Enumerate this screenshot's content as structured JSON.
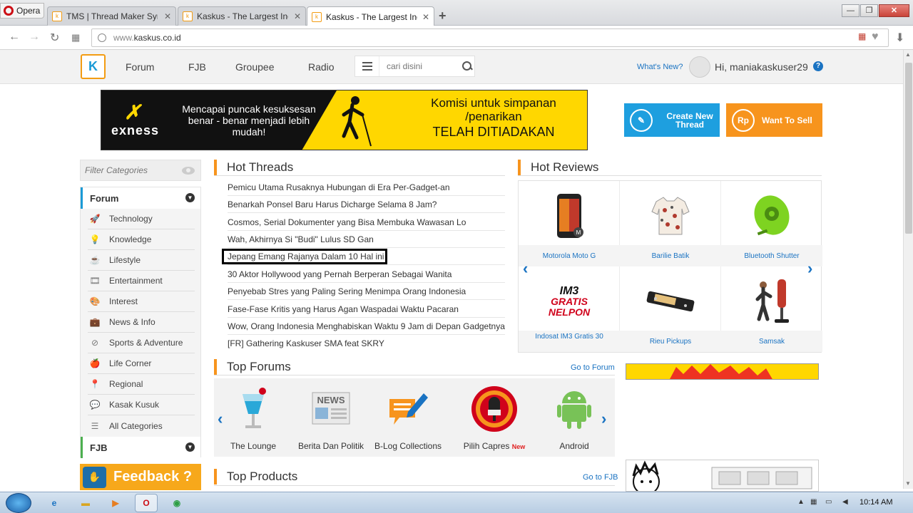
{
  "browser": {
    "menu_label": "Opera",
    "tabs": [
      {
        "title": "TMS | Thread Maker Synd",
        "favicon": "kaskus-favicon"
      },
      {
        "title": "Kaskus - The Largest Indo",
        "favicon": "kaskus-favicon"
      },
      {
        "title": "Kaskus - The Largest Indo",
        "favicon": "kaskus-favicon",
        "active": true
      }
    ],
    "new_tab": "+",
    "url_host": "www.",
    "url_domain": "kaskus.co.id",
    "window_controls": {
      "minimize": "—",
      "maximize": "❐",
      "close": "✕"
    }
  },
  "header": {
    "logo": "K",
    "nav": [
      "Forum",
      "FJB",
      "Groupee",
      "Radio"
    ],
    "search_placeholder": "cari disini",
    "whats_new": "What's New?",
    "greeting": "Hi, maniakaskuser29",
    "help": "?"
  },
  "banner": {
    "brand": "exness",
    "line1": "Mencapai puncak kesuksesan benar - benar menjadi lebih mudah!",
    "line2": "Komisi untuk simpanan /penarikan",
    "line3": "TELAH DITIADAKAN"
  },
  "cta": {
    "create_thread": "Create New Thread",
    "create_icon": "pencil-icon",
    "want_to_sell": "Want To Sell",
    "sell_icon_text": "Rp"
  },
  "sidebar": {
    "filter_placeholder": "Filter Categories",
    "forum_heading": "Forum",
    "items": [
      {
        "label": "Technology",
        "icon": "rocket-icon"
      },
      {
        "label": "Knowledge",
        "icon": "bulb-icon"
      },
      {
        "label": "Lifestyle",
        "icon": "cup-icon"
      },
      {
        "label": "Entertainment",
        "icon": "film-icon"
      },
      {
        "label": "Interest",
        "icon": "palette-icon"
      },
      {
        "label": "News & Info",
        "icon": "briefcase-icon"
      },
      {
        "label": "Sports & Adventure",
        "icon": "compass-icon"
      },
      {
        "label": "Life Corner",
        "icon": "apple-icon"
      },
      {
        "label": "Regional",
        "icon": "pin-icon"
      },
      {
        "label": "Kasak Kusuk",
        "icon": "chat-icon"
      },
      {
        "label": "All Categories",
        "icon": "list-icon"
      }
    ],
    "fjb_heading": "FJB",
    "feedback": "Feedback ?"
  },
  "hot_threads": {
    "title": "Hot Threads",
    "items": [
      "Pemicu Utama Rusaknya Hubungan di Era Per-Gadget-an",
      "Benarkah Ponsel Baru Harus Dicharge Selama 8 Jam?",
      "Cosmos, Serial Dokumenter yang Bisa Membuka Wawasan Lo",
      "Wah, Akhirnya Si \"Budi\" Lulus SD Gan",
      "Jepang Emang Rajanya Dalam 10 Hal ini",
      "30 Aktor Hollywood yang Pernah Berperan Sebagai Wanita",
      "Penyebab Stres yang Paling Sering Menimpa Orang Indonesia",
      "Fase-Fase Kritis yang Harus Agan Waspadai Waktu Pacaran",
      "Wow, Orang Indonesia Menghabiskan Waktu 9 Jam di Depan Gadgetnya",
      "[FR] Gathering Kaskuser SMA feat SKRY"
    ]
  },
  "hot_reviews": {
    "title": "Hot Reviews",
    "items": [
      {
        "label": "Motorola Moto G",
        "icon": "phone-icon"
      },
      {
        "label": "Barilie Batik",
        "icon": "shirt-icon"
      },
      {
        "label": "Bluetooth Shutter",
        "icon": "remote-icon"
      },
      {
        "label": "Indosat IM3 Gratis 30",
        "icon": "im3-logo-icon",
        "logo_line1": "IM3",
        "logo_line2": "GRATIS",
        "logo_line3": "NELPON"
      },
      {
        "label": "Rieu Pickups",
        "icon": "pickup-icon"
      },
      {
        "label": "Samsak",
        "icon": "punching-bag-icon"
      }
    ]
  },
  "top_forums": {
    "title": "Top Forums",
    "go_link": "Go to Forum",
    "items": [
      {
        "label": "The Lounge",
        "icon": "cocktail-icon"
      },
      {
        "label": "Berita Dan Politik",
        "icon": "news-icon",
        "badge_text": "NEWS"
      },
      {
        "label": "B-Log Collections",
        "icon": "blog-icon"
      },
      {
        "label": "Pilih Capres",
        "icon": "microphone-icon",
        "new_badge": "New"
      },
      {
        "label": "Android",
        "icon": "android-icon"
      }
    ]
  },
  "top_products": {
    "title": "Top Products",
    "go_link": "Go to FJB"
  },
  "taskbar": {
    "time": "10:14 AM"
  },
  "colors": {
    "kaskus_blue": "#1a9ad6",
    "kaskus_orange": "#f7941d",
    "link_blue": "#1a73c2"
  }
}
